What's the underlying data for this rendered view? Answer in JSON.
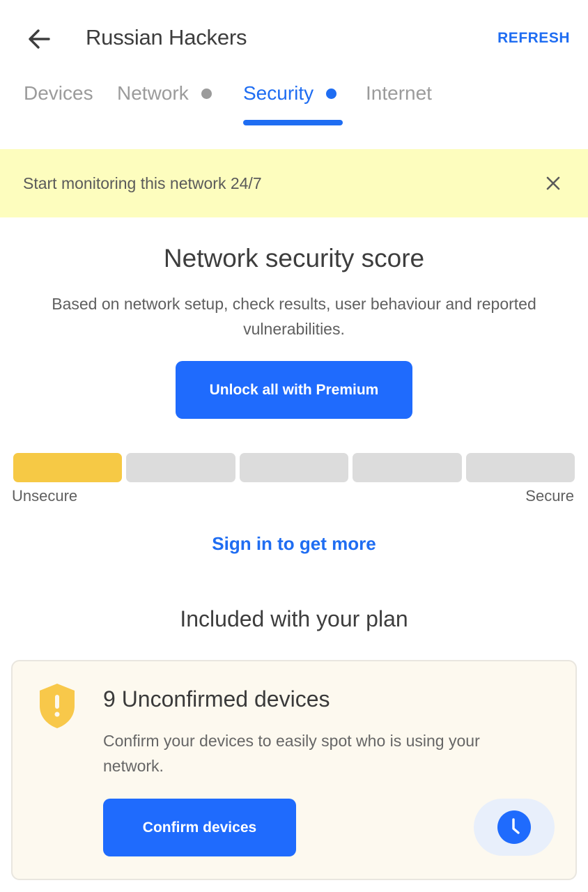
{
  "header": {
    "back_icon": "arrow-left-icon",
    "title": "Russian Hackers",
    "refresh_label": "REFRESH"
  },
  "tabs": [
    {
      "label": "Devices",
      "active": false,
      "dot": false
    },
    {
      "label": "Network",
      "active": false,
      "dot": true
    },
    {
      "label": "Security",
      "active": true,
      "dot": true
    },
    {
      "label": "Internet",
      "active": false,
      "dot": false
    }
  ],
  "banner": {
    "text": "Start monitoring this network 24/7",
    "close_icon": "close-icon",
    "background": "#fdfdbe"
  },
  "score": {
    "title": "Network security score",
    "description": "Based on network setup, check results, user behaviour and reported vulnerabilities.",
    "premium_button": "Unlock all with Premium",
    "level": 1,
    "max_level": 5,
    "label_low": "Unsecure",
    "label_high": "Secure",
    "fill_color": "#f6c945",
    "empty_color": "#dcdcdc",
    "signin_link": "Sign in to get more"
  },
  "plan": {
    "title": "Included with your plan",
    "card": {
      "icon": "shield-alert-icon",
      "title": "9 Unconfirmed devices",
      "description": "Confirm your devices to easily spot who is using your network.",
      "button": "Confirm devices",
      "secondary_icon": "clock-icon"
    }
  },
  "colors": {
    "accent": "#1f6df2",
    "button": "#1f6bfd",
    "warning": "#f6c945"
  }
}
